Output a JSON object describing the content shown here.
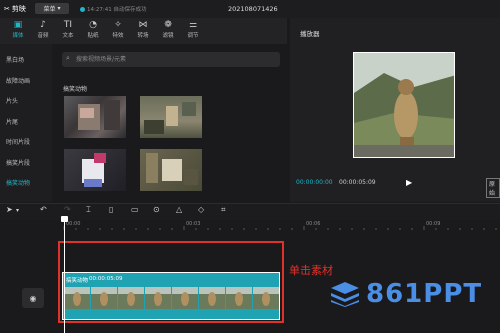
{
  "app": {
    "name": "剪映",
    "menu_label": "菜单",
    "autosave": "14:27:41 自动保存成功",
    "project_title": "202108071426"
  },
  "toolbar": {
    "items": [
      {
        "label": "媒体",
        "icon": "media-icon",
        "glyph": "▣",
        "active": true
      },
      {
        "label": "音频",
        "icon": "audio-icon",
        "glyph": "♪",
        "active": false
      },
      {
        "label": "文本",
        "icon": "text-icon",
        "glyph": "TI",
        "active": false
      },
      {
        "label": "贴纸",
        "icon": "sticker-icon",
        "glyph": "◔",
        "active": false
      },
      {
        "label": "特效",
        "icon": "effects-icon",
        "glyph": "✧",
        "active": false
      },
      {
        "label": "转场",
        "icon": "transition-icon",
        "glyph": "⋈",
        "active": false
      },
      {
        "label": "滤镜",
        "icon": "filter-icon",
        "glyph": "❁",
        "active": false
      },
      {
        "label": "调节",
        "icon": "adjust-icon",
        "glyph": "⚌",
        "active": false
      }
    ]
  },
  "sidebar": {
    "items": [
      "黑白场",
      "故障动画",
      "片头",
      "片尾",
      "时间片段",
      "搞笑片段",
      "搞笑动物"
    ],
    "active_index": 6
  },
  "search": {
    "placeholder": "搜索视频场景/元素"
  },
  "library": {
    "section_title": "搞笑动物"
  },
  "player": {
    "title": "播放器",
    "current_time": "00:00:00:00",
    "total_time": "00:00:05:09",
    "ratio_label": "原始"
  },
  "timeline": {
    "ruler_labels": [
      "00:00",
      "00:03",
      "00:06",
      "00:09"
    ],
    "clip": {
      "label": "搞笑动物",
      "duration": "00:00:05:09"
    },
    "annotation": "单击素材"
  },
  "watermark": {
    "text": "861PPT"
  },
  "colors": {
    "accent": "#1fb6c8",
    "annotation": "#e0312b",
    "watermark": "#4a8ee6"
  }
}
